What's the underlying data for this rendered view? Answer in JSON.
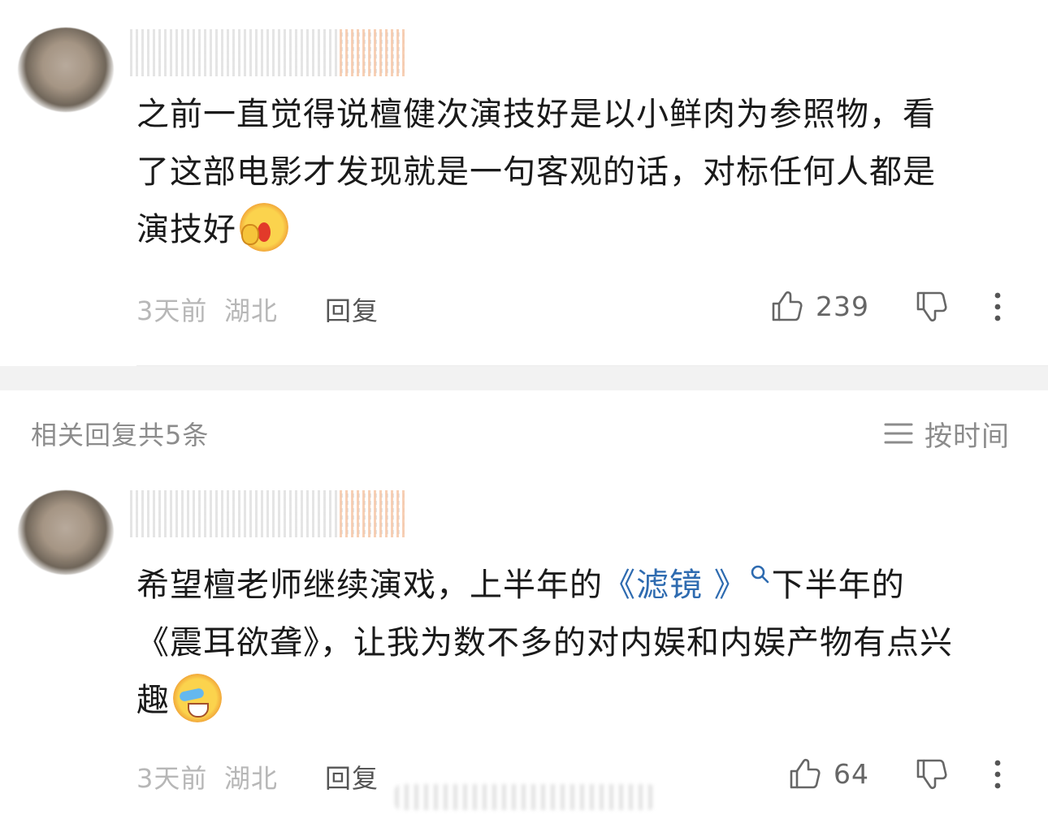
{
  "main_comment": {
    "text_lines": [
      "之前一直觉得说檀健次演技好是以小鲜肉为参照物，看",
      "了这部电影才发现就是一句客观的话，对标任何人都是",
      "演技好"
    ],
    "emoji": "shocked-face-emoji",
    "time": "3天前",
    "location": "湖北",
    "reply_label": "回复",
    "like_count": "239"
  },
  "replies_section": {
    "title": "相关回复共5条",
    "sort_label": "按时间",
    "sort_icon": "list-icon"
  },
  "reply_comment": {
    "text_line1_before_link": "希望檀老师继续演戏，上半年的",
    "link_text": "《滤镜 》",
    "text_line1_after_link": "下半年的",
    "text_line2": "《震耳欲聋》，让我为数不多的对内娱和内娱产物有点兴",
    "text_line3": "趣",
    "emoji": "laughing-cry-face-emoji",
    "time": "3天前",
    "location": "湖北",
    "reply_label": "回复",
    "like_count": "64"
  },
  "colors": {
    "link": "#2e6bb0",
    "meta": "#b7b7b7",
    "body": "#1a1a1a",
    "section_bg": "#f2f2f2"
  }
}
